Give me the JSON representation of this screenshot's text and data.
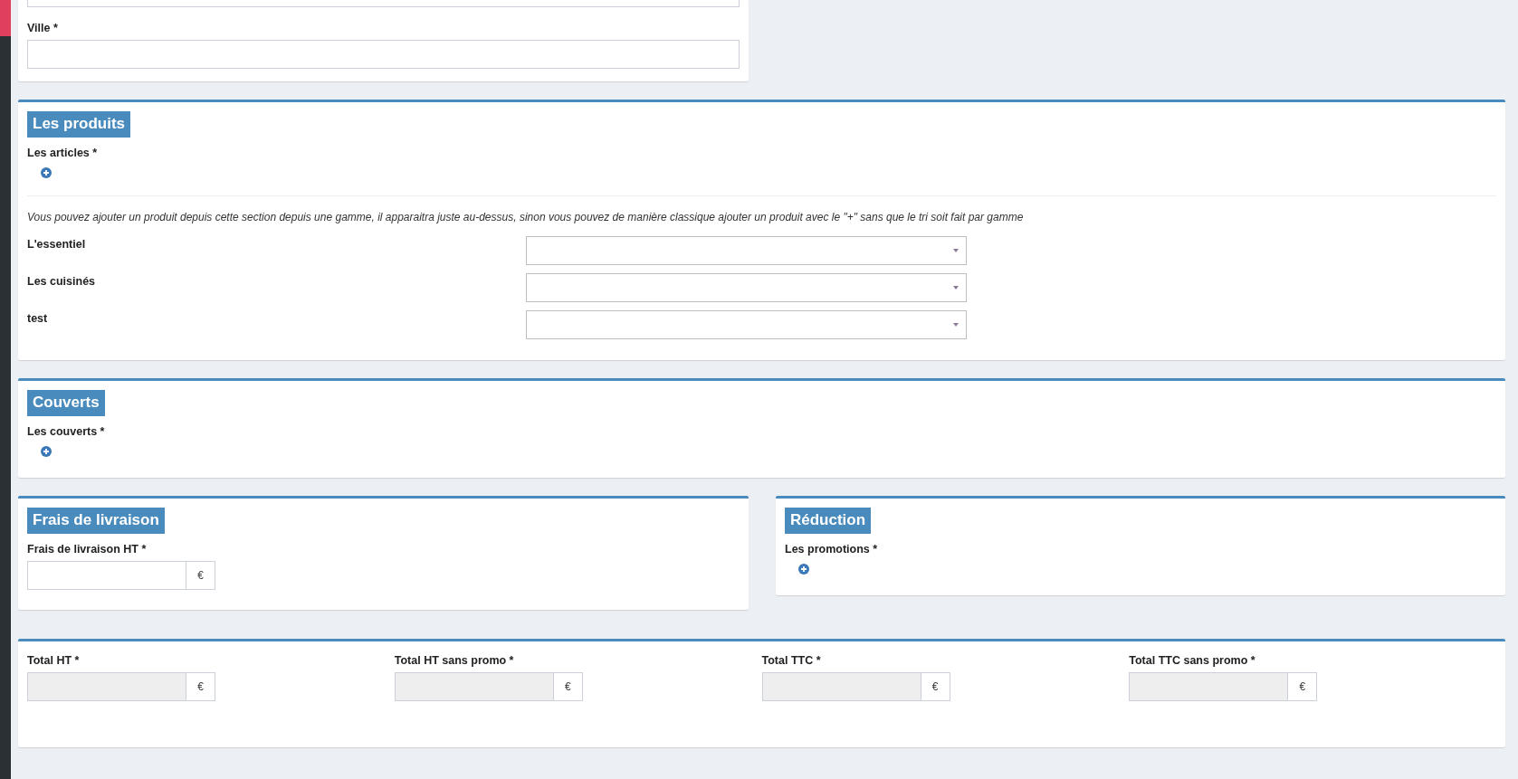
{
  "address": {
    "label": "Ville *"
  },
  "products": {
    "title": "Les produits",
    "list_label": "Les articles *",
    "note": "Vous pouvez ajouter un produit depuis cette section depuis une gamme, il apparaitra juste au-dessus, sinon vous pouvez de manière classique ajouter un produit avec le \"+\" sans que le tri soit fait par gamme",
    "ranges": [
      {
        "label": "L'essentiel"
      },
      {
        "label": "Les cuisinés"
      },
      {
        "label": "test"
      }
    ]
  },
  "covers": {
    "title": "Couverts",
    "list_label": "Les couverts *"
  },
  "delivery": {
    "title": "Frais de livraison",
    "field_label": "Frais de livraison HT *",
    "unit": "€"
  },
  "reduction": {
    "title": "Réduction",
    "list_label": "Les promotions *"
  },
  "totals": [
    {
      "label": "Total HT *",
      "unit": "€",
      "disabled": true
    },
    {
      "label": "Total HT sans promo *",
      "unit": "€",
      "disabled": true
    },
    {
      "label": "Total TTC *",
      "unit": "€",
      "disabled": true
    },
    {
      "label": "Total TTC sans promo *",
      "unit": "€",
      "disabled": true
    }
  ]
}
